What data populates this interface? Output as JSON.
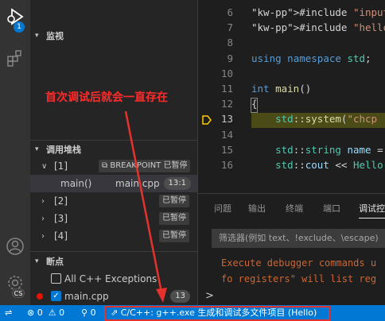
{
  "activity": {
    "debug_badge": "1",
    "account_badge": "CS"
  },
  "sidebar": {
    "watch_header": "监视",
    "callstack_header": "调用堆栈",
    "callstack": [
      {
        "label": "[1]",
        "tag": "BREAKPOINT 已暂停",
        "expanded": true
      },
      {
        "frame": "main()",
        "file": "main.cpp",
        "pos": "13:1"
      },
      {
        "label": "[2]",
        "tag": "已暂停"
      },
      {
        "label": "[3]",
        "tag": "已暂停"
      },
      {
        "label": "[4]",
        "tag": "已暂停"
      }
    ],
    "breakpoints_header": "断点",
    "breakpoints": [
      {
        "label": "All C++ Exceptions",
        "checked": false
      },
      {
        "label": "main.cpp",
        "checked": true,
        "count": "13"
      }
    ]
  },
  "editor": {
    "lines": [
      {
        "num": "6",
        "text": "#include \"input.hpp\" /"
      },
      {
        "num": "7",
        "text": "#include \"hello.hpp\" /"
      },
      {
        "num": "8",
        "text": ""
      },
      {
        "num": "9",
        "text": "using namespace std;"
      },
      {
        "num": "10",
        "text": ""
      },
      {
        "num": "11",
        "text": "int main()"
      },
      {
        "num": "12",
        "text": "{"
      },
      {
        "num": "13",
        "text": "    std::system(\"chcp"
      },
      {
        "num": "14",
        "text": ""
      },
      {
        "num": "15",
        "text": "    std::string name ="
      },
      {
        "num": "16",
        "text": "    std::cout << Hello"
      }
    ],
    "current_line": "13"
  },
  "panel": {
    "tabs": [
      "问题",
      "输出",
      "终端",
      "端口",
      "调试控"
    ],
    "active_tab": "调试控",
    "filter_placeholder": "筛选器(例如 text、!exclude、\\escape)",
    "output_lines": [
      "Execute debugger commands u",
      "fo registers\" will list reg"
    ],
    "prompt": ">"
  },
  "status": {
    "remote": "⇌",
    "errors": "0",
    "warnings": "0",
    "ports": "0",
    "launch": "C/C++: g++.exe 生成和调试多文件项目 (Hello)"
  },
  "annotation": "首次调试后就会一直存在",
  "colors": {
    "accent": "#0078d4",
    "annotation": "#ff2b2b",
    "breakpoint": "#e51400"
  }
}
